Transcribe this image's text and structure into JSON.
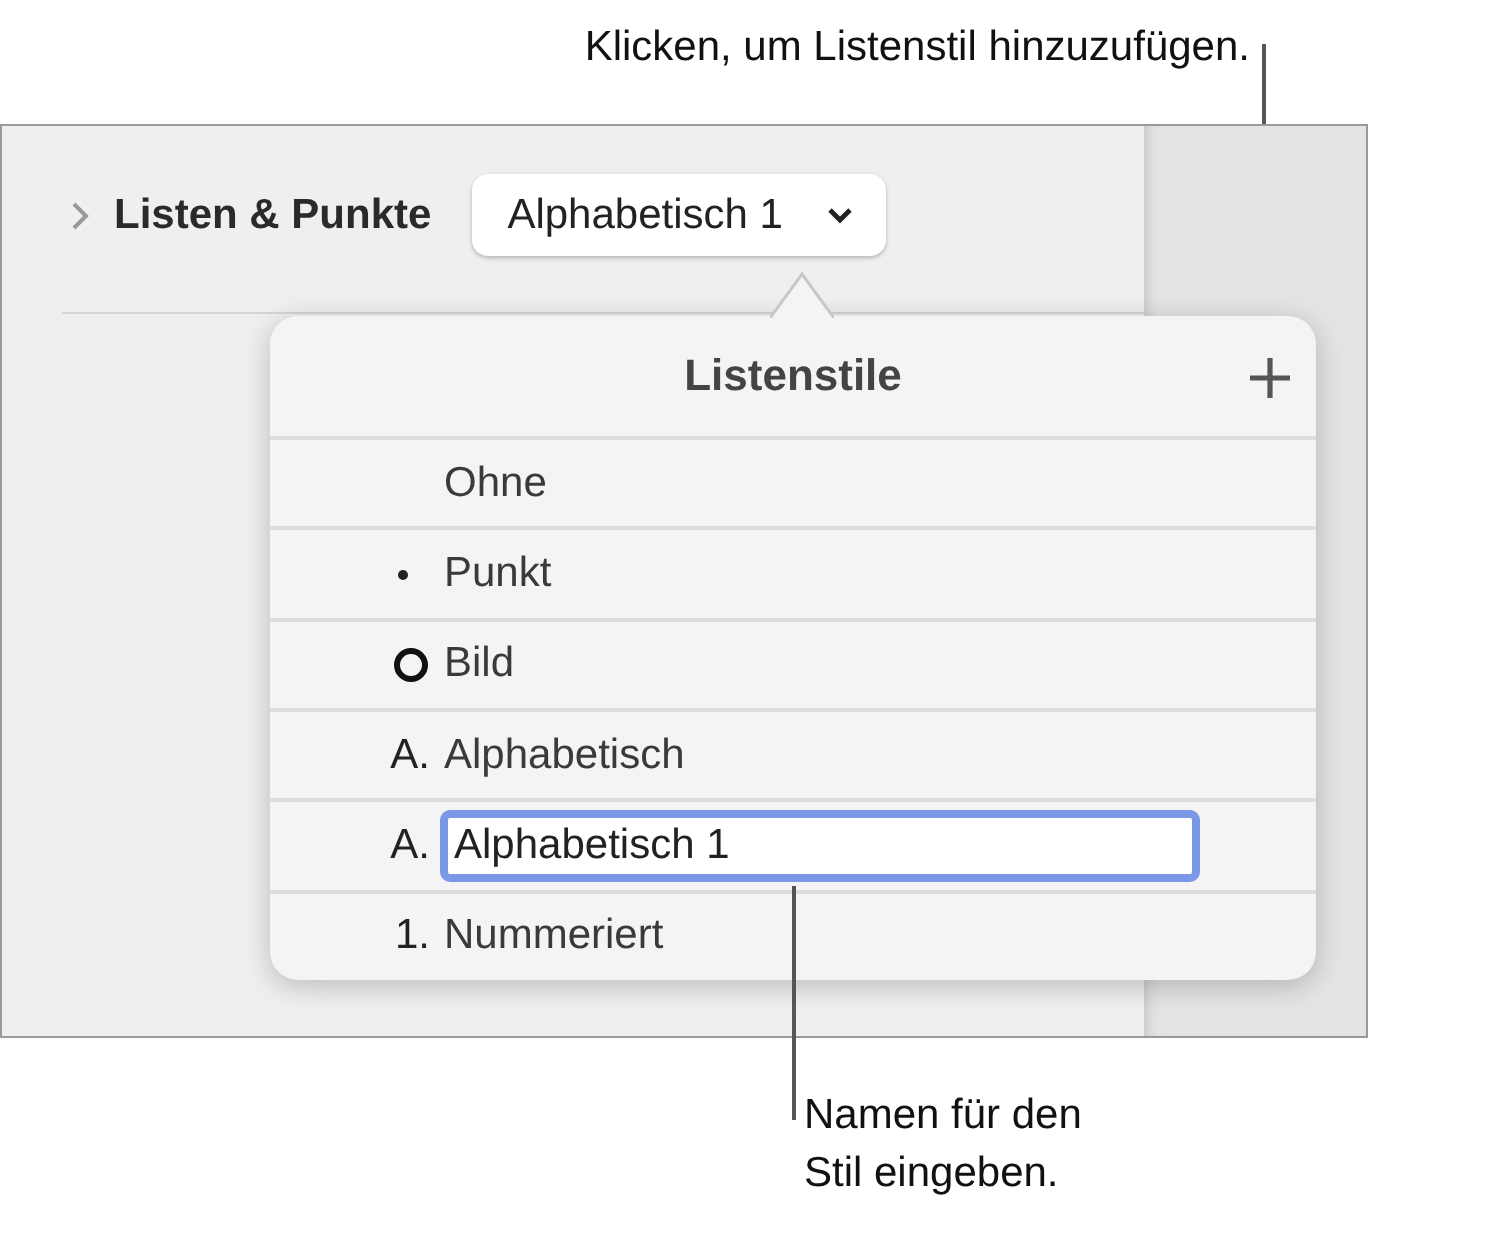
{
  "callouts": [
    {
      "kind": "top",
      "text": "Klicken, um Listenstil hinzuzufügen."
    },
    {
      "kind": "bottom",
      "text": "Namen für den Stil eingeben."
    }
  ],
  "section": {
    "title": "Listen & Punkte",
    "expanded": false,
    "dropdown_value": "Alphabetisch 1"
  },
  "popover": {
    "title": "Listenstile",
    "items": [
      {
        "kind": "none",
        "label": "Ohne",
        "editing": false
      },
      {
        "kind": "bullet",
        "label": "Punkt",
        "editing": false
      },
      {
        "kind": "image",
        "label": "Bild",
        "editing": false
      },
      {
        "kind": "text",
        "marker": "A.",
        "label": "Alphabetisch",
        "editing": false
      },
      {
        "kind": "text",
        "marker": "A.",
        "label": "Alphabetisch 1",
        "editing": true
      },
      {
        "kind": "text",
        "marker": "1.",
        "label": "Nummeriert",
        "editing": false
      }
    ]
  }
}
